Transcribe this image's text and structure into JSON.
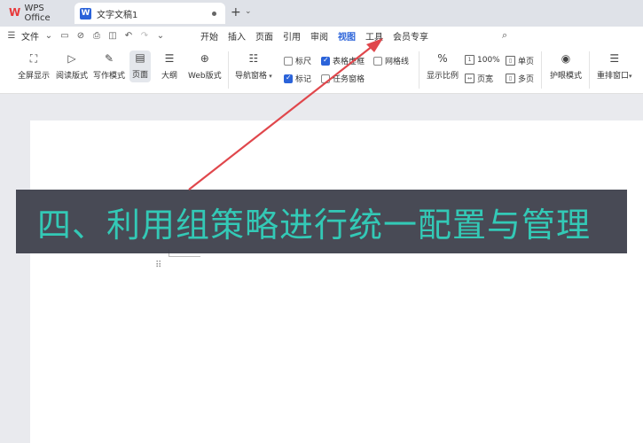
{
  "tabbar": {
    "app_name": "WPS Office",
    "doc_tab": "文字文稿1",
    "new_tab": "+",
    "new_tab_arrow": "⌄"
  },
  "menubar": {
    "file": "文件",
    "tabs": [
      {
        "label": "开始",
        "active": false
      },
      {
        "label": "插入",
        "active": false
      },
      {
        "label": "页面",
        "active": false
      },
      {
        "label": "引用",
        "active": false
      },
      {
        "label": "审阅",
        "active": false
      },
      {
        "label": "视图",
        "active": true
      },
      {
        "label": "工具",
        "active": false
      },
      {
        "label": "会员专享",
        "active": false
      }
    ]
  },
  "ribbon": {
    "fullscreen": "全屏显示",
    "reading": "阅读版式",
    "writing": "写作模式",
    "page": "页面",
    "outline": "大纲",
    "web": "Web版式",
    "nav_pane": "导航窗格",
    "ruler": "标尺",
    "table_borders": "表格虚框",
    "gridlines": "网格线",
    "marks": "标记",
    "task_pane": "任务窗格",
    "zoom_ratio": "显示比例",
    "zoom_100": "100%",
    "page_width": "页宽",
    "single_page": "单页",
    "multi_page": "多页",
    "eye_protect": "护眼模式",
    "rearrange": "重排窗口"
  },
  "banner": {
    "text": "四、利用组策略进行统一配置与管理"
  },
  "colors": {
    "accent": "#2b63d9",
    "banner_bg": "#3a3c48",
    "banner_text": "#33c9b6",
    "arrow": "#e0474c"
  }
}
